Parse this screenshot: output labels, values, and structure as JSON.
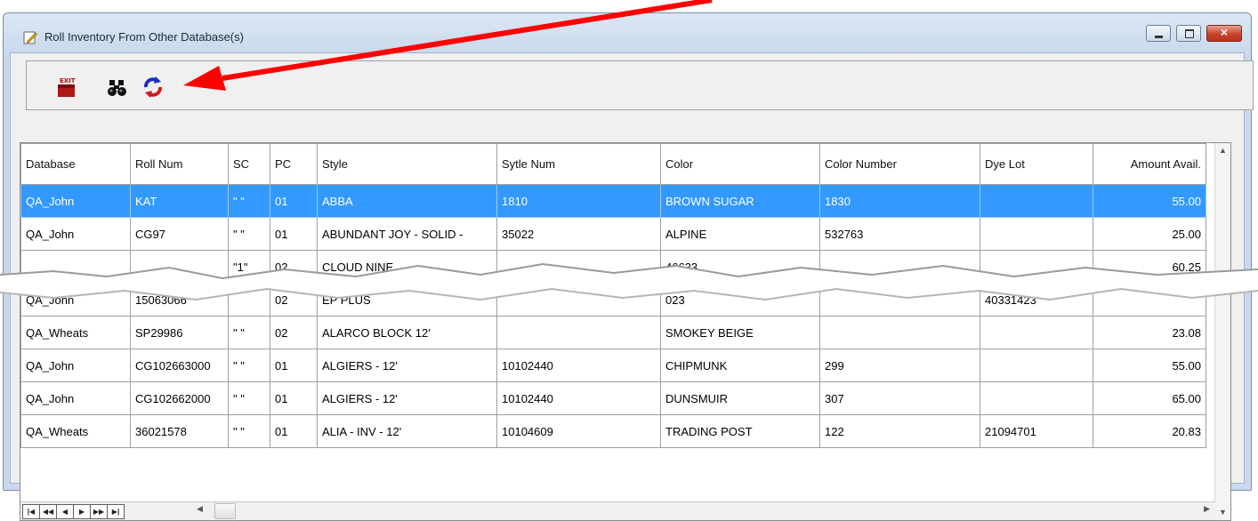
{
  "window": {
    "title": "Roll Inventory From Other Database(s)"
  },
  "toolbar": {
    "exit_label": "EXIT"
  },
  "columns": [
    "Database",
    "Roll Num",
    "SC",
    "PC",
    "Style",
    "Sytle Num",
    "Color",
    "Color Number",
    "Dye Lot",
    "Amount Avail."
  ],
  "rows": [
    {
      "db": "QA_John",
      "roll": "KAT",
      "sc": "\" \"",
      "pc": "01",
      "style": "ABBA",
      "style_num": "1810",
      "color": "BROWN SUGAR",
      "color_num": "1830",
      "dye_lot": "",
      "amount": "55.00"
    },
    {
      "db": "QA_John",
      "roll": "CG97",
      "sc": "\" \"",
      "pc": "01",
      "style": "ABUNDANT JOY - SOLID -",
      "style_num": "35022",
      "color": "ALPINE",
      "color_num": "532763",
      "dye_lot": "",
      "amount": "25.00"
    },
    {
      "db": "",
      "roll": "",
      "sc": "\"1\"",
      "pc": "02",
      "style": "CLOUD NINE",
      "style_num": "",
      "color": "46633",
      "color_num": "",
      "dye_lot": "",
      "amount": "60.25"
    },
    {
      "db": "QA_John",
      "roll": "15063066",
      "sc": "",
      "pc": "02",
      "style": "EP PLUS",
      "style_num": "",
      "color": "023",
      "color_num": "",
      "dye_lot": "40331423",
      "amount": ""
    },
    {
      "db": "QA_Wheats",
      "roll": "SP29986",
      "sc": "\" \"",
      "pc": "02",
      "style": "ALARCO BLOCK 12'",
      "style_num": "",
      "color": "SMOKEY BEIGE",
      "color_num": "",
      "dye_lot": "",
      "amount": "23.08"
    },
    {
      "db": "QA_John",
      "roll": "CG102663000",
      "sc": "\" \"",
      "pc": "01",
      "style": "ALGIERS - 12'",
      "style_num": "10102440",
      "color": "CHIPMUNK",
      "color_num": "299",
      "dye_lot": "",
      "amount": "55.00"
    },
    {
      "db": "QA_John",
      "roll": "CG102662000",
      "sc": "\" \"",
      "pc": "01",
      "style": "ALGIERS - 12'",
      "style_num": "10102440",
      "color": "DUNSMUIR",
      "color_num": "307",
      "dye_lot": "",
      "amount": "65.00"
    },
    {
      "db": "QA_Wheats",
      "roll": "36021578",
      "sc": "\" \"",
      "pc": "01",
      "style": "ALIA - INV - 12'",
      "style_num": "10104609",
      "color": "TRADING POST",
      "color_num": "122",
      "dye_lot": "21094701",
      "amount": "20.83"
    }
  ],
  "colors": {
    "selection": "#3399ff",
    "arrow": "#ff0000",
    "close_button": "#c7442c"
  },
  "icons": [
    "edit-icon",
    "exit-icon",
    "binoculars-icon",
    "refresh-icon",
    "first-record-icon",
    "prev-page-icon",
    "prev-record-icon",
    "next-record-icon",
    "next-page-icon",
    "last-record-icon"
  ]
}
